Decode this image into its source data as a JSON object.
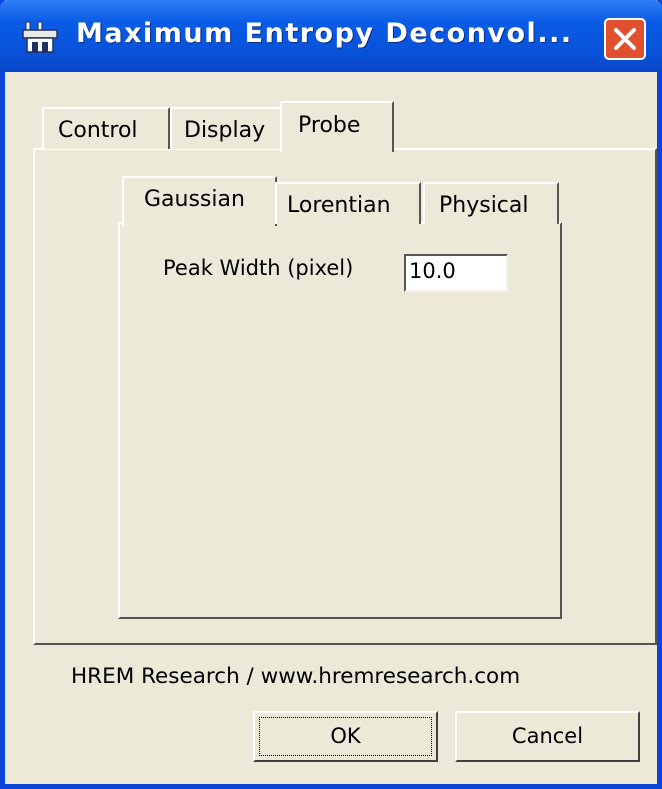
{
  "window": {
    "title": "Maximum Entropy Deconvol...",
    "app_icon": "plugin-icon",
    "close_icon": "close-icon"
  },
  "tabs_main": [
    {
      "label": "Control",
      "selected": false
    },
    {
      "label": "Display",
      "selected": false
    },
    {
      "label": "Probe",
      "selected": true
    }
  ],
  "tabs_probe": [
    {
      "label": "Gaussian",
      "selected": true
    },
    {
      "label": "Lorentian",
      "selected": false
    },
    {
      "label": "Physical",
      "selected": false
    }
  ],
  "gaussian": {
    "peak_width_label": "Peak Width (pixel)",
    "peak_width_value": "10.0"
  },
  "footer": {
    "credit": "HREM Research / www.hremresearch.com",
    "ok_label": "OK",
    "cancel_label": "Cancel"
  },
  "colors": {
    "titlebar": "#0a5ce6",
    "close_button": "#e0502e",
    "dialog_face": "#ece9d8"
  }
}
